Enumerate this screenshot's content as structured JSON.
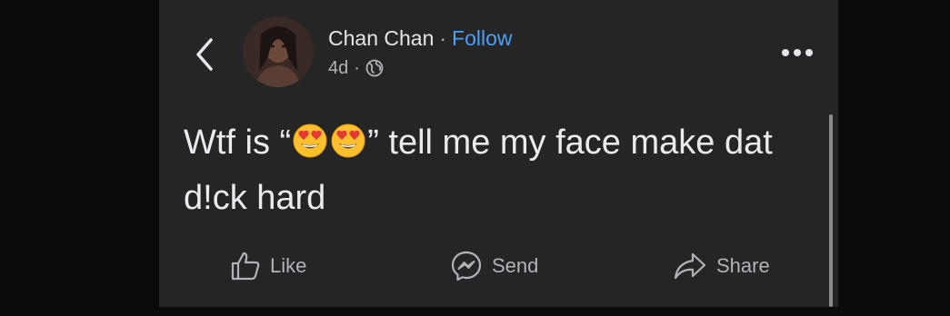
{
  "post": {
    "author": {
      "name": "Chan Chan",
      "separator": "·",
      "follow_label": "Follow"
    },
    "meta": {
      "time": "4d",
      "separator": "·",
      "audience_icon": "globe-icon"
    },
    "text": {
      "prefix": "Wtf is “",
      "suffix": "” tell me my face make dat d!ck hard",
      "emojis": [
        "heart-eyes-emoji",
        "heart-eyes-emoji"
      ]
    }
  },
  "actions": {
    "like_label": "Like",
    "send_label": "Send",
    "share_label": "Share"
  },
  "colors": {
    "background": "#252526",
    "text": "#e4e6eb",
    "secondary_text": "#b0b3b8",
    "link": "#4d9ef6"
  }
}
